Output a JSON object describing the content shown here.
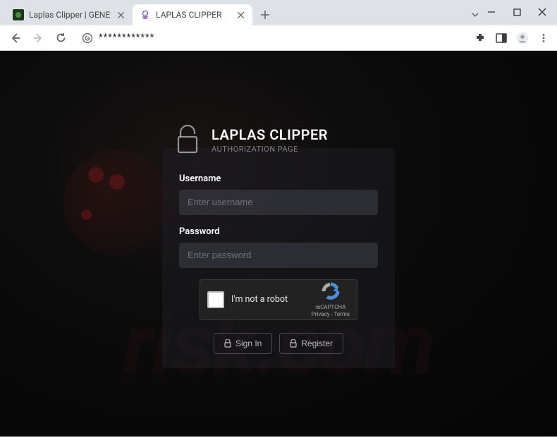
{
  "window": {
    "tabs": [
      {
        "title": "Laplas Clipper | GENERATION OF",
        "active": false
      },
      {
        "title": "LAPLAS CLIPPER",
        "active": true
      }
    ]
  },
  "addressbar": {
    "url_display": "************"
  },
  "login": {
    "title": "LAPLAS CLIPPER",
    "subtitle": "AUTHORIZATION PAGE",
    "username_label": "Username",
    "username_placeholder": "Enter username",
    "password_label": "Password",
    "password_placeholder": "Enter password",
    "recaptcha_label": "I'm not a robot",
    "recaptcha_brand": "reCAPTCHA",
    "recaptcha_terms": "Privacy - Terms",
    "signin_label": "Sign In",
    "register_label": "Register"
  },
  "watermark": "risk.com"
}
